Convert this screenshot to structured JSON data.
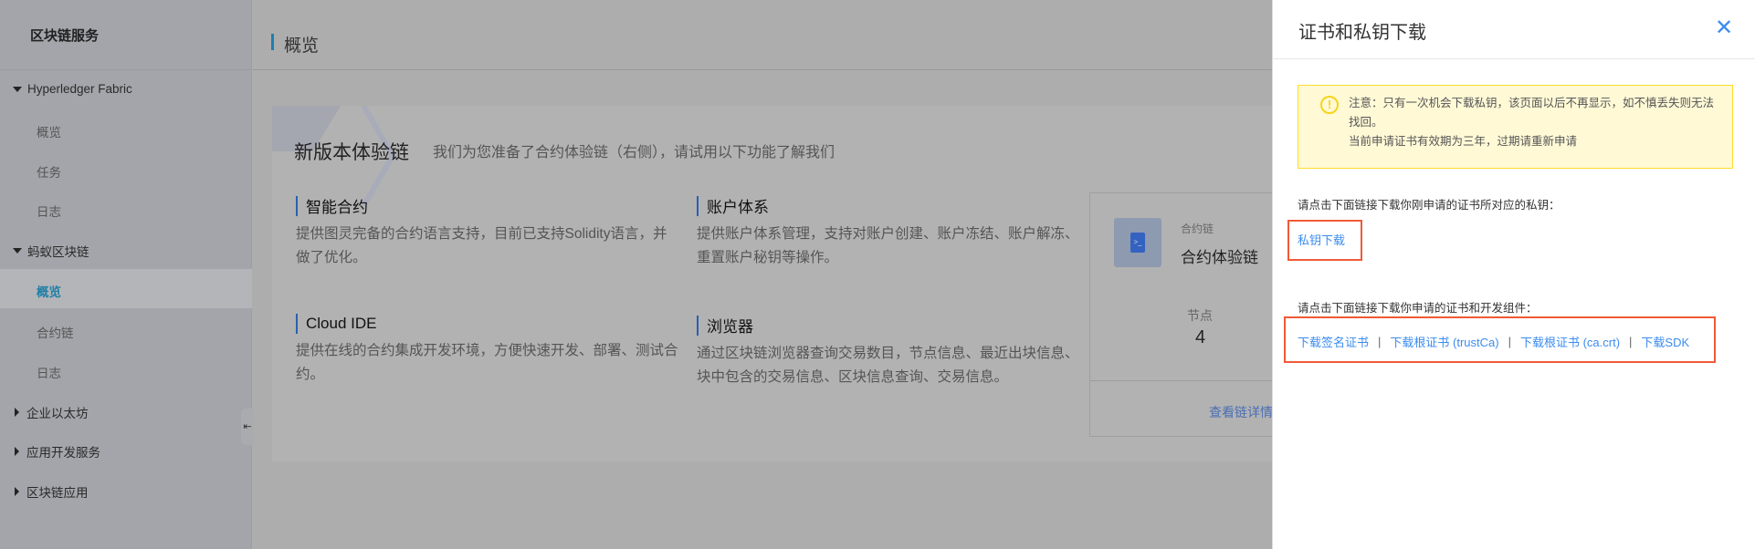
{
  "sidebar": {
    "title": "区块链服务",
    "groups": [
      {
        "label": "Hyperledger Fabric",
        "items": [
          "概览",
          "任务",
          "日志"
        ]
      },
      {
        "label": "蚂蚁区块链",
        "items": [
          "概览",
          "合约链",
          "日志"
        ]
      },
      {
        "label": "企业以太坊"
      },
      {
        "label": "应用开发服务"
      },
      {
        "label": "区块链应用"
      }
    ],
    "active_item": "概览"
  },
  "header": {
    "title": "概览"
  },
  "main": {
    "title": "新版本体验链",
    "subtitle": "我们为您准备了合约体验链（右侧），请试用以下功能了解我们",
    "features": [
      {
        "title": "智能合约",
        "desc": "提供图灵完备的合约语言支持，目前已支持Solidity语言，并做了优化。"
      },
      {
        "title": "账户体系",
        "desc": "提供账户体系管理，支持对账户创建、账户冻结、账户解冻、重置账户秘钥等操作。"
      },
      {
        "title": "Cloud IDE",
        "desc": "提供在线的合约集成开发环境，方便快速开发、部署、测试合约。"
      },
      {
        "title": "浏览器",
        "desc": "通过区块链浏览器查询交易数目，节点信息、最近出块信息、块中包含的交易信息、区块信息查询、交易信息。"
      }
    ],
    "chain_card": {
      "type_label": "合约链",
      "name": "合约体验链",
      "nodes_label": "节点",
      "nodes_value": "4",
      "details_link": "查看链详情"
    }
  },
  "drawer": {
    "title": "证书和私钥下载",
    "alert_lines": [
      "注意：只有一次机会下载私钥，该页面以后不再显示，如不慎丢失则无法找回。",
      "当前申请证书有效期为三年，过期请重新申请"
    ],
    "private_key_prompt": "请点击下面链接下载你刚申请的证书所对应的私钥：",
    "private_key_link": "私钥下载",
    "cert_prompt": "请点击下面链接下载你申请的证书和开发组件：",
    "cert_links": [
      "下载签名证书",
      "下载根证书 (trustCa)",
      "下载根证书 (ca.crt)",
      "下载SDK"
    ],
    "separator": "|"
  },
  "colors": {
    "link": "#3b8cf0",
    "highlight": "#f05a38",
    "alert_bg": "#fff9d6",
    "accent": "#1e7fb0"
  }
}
